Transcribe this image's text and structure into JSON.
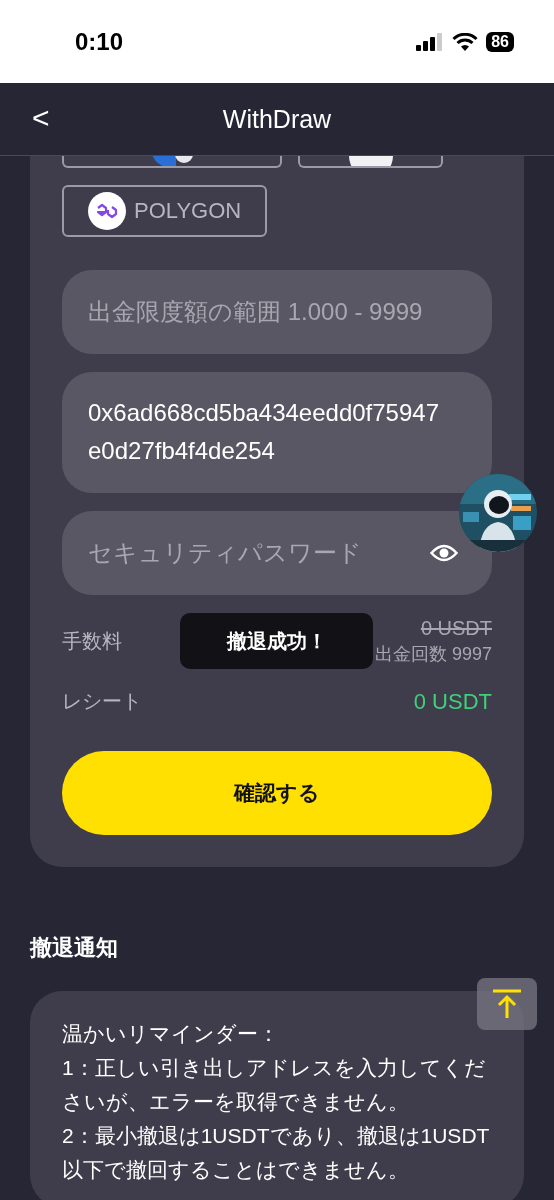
{
  "status_bar": {
    "time": "0:10",
    "battery": "86"
  },
  "header": {
    "back": "<",
    "title": "WithDraw"
  },
  "networks": [
    {
      "label": "POLYGON",
      "selected": false
    }
  ],
  "amount_field": {
    "placeholder": "出金限度額の範囲 1.000 - 9999"
  },
  "address_field": {
    "value": "0x6ad668cd5ba434eedd0f75947e0d27fb4f4de254"
  },
  "password_field": {
    "placeholder": "セキュリティパスワード"
  },
  "fee": {
    "label": "手数料",
    "original": "0 USDT",
    "remaining": "出金回数 9997"
  },
  "receipt": {
    "label": "レシート",
    "value": "0 USDT"
  },
  "confirm_button": "確認する",
  "toast": "撤退成功！",
  "notice": {
    "title": "撤退通知",
    "lines": [
      "温かいリマインダー：",
      "1：正しい引き出しアドレスを入力してくださいが、エラーを取得できません。",
      "2：最小撤退は1USDTであり、撤退は1USDT以下で撤回することはできません。"
    ]
  }
}
